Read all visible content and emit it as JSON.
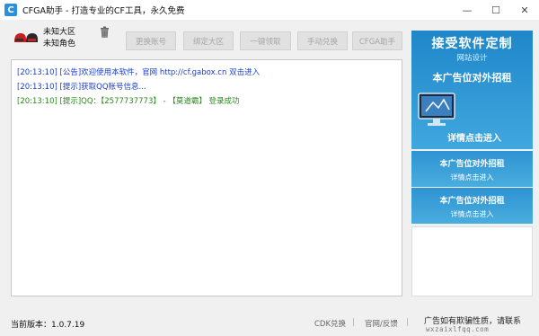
{
  "window": {
    "title": "CFGA助手 - 打造专业的CF工具，永久免费",
    "app_icon_letter": "C",
    "minimize_symbol": "—",
    "maximize_symbol": "☐",
    "close_symbol": "✕"
  },
  "user": {
    "region": "未知大区",
    "role": "未知角色"
  },
  "toolbar": {
    "buttons": [
      "更换账号",
      "绑定大区",
      "一键领取",
      "手动兑换",
      "CFGA助手"
    ]
  },
  "log": [
    {
      "time": "[20:13:10]",
      "text": "[公告]欢迎使用本软件，官网 http://cf.gabox.cn 双击进入",
      "color": "#1a3ec8"
    },
    {
      "time": "[20:13:10]",
      "text": "[提示]获取QQ账号信息...",
      "color": "#1a3ec8"
    },
    {
      "time": "[20:13:10]",
      "text": "[提示]QQ：【2577737773】 - 【莫道霸】 登录成功",
      "color": "#2c8a1e"
    }
  ],
  "ads": {
    "banner_title": "接受软件定制",
    "banner_sub": "网站设计",
    "banner_line": "本广告位对外招租",
    "banner_cta": "详情点击进入",
    "box1_line1": "本广告位对外招租",
    "box1_line2": "详情点击进入",
    "box2_line1": "本广告位对外招租",
    "box2_line2": "详情点击进入"
  },
  "status": {
    "version": "当前版本：1.0.7.19",
    "cdk_link": "CDK兑换",
    "sep1": "|",
    "site_link": "官网/反馈",
    "sep2": "|",
    "notice": "广告如有欺骗性质，请联系",
    "watermark": "wxzaixlfqq.com"
  },
  "icons": {
    "avatar": "helmet-icon",
    "trash": "trash-icon"
  }
}
